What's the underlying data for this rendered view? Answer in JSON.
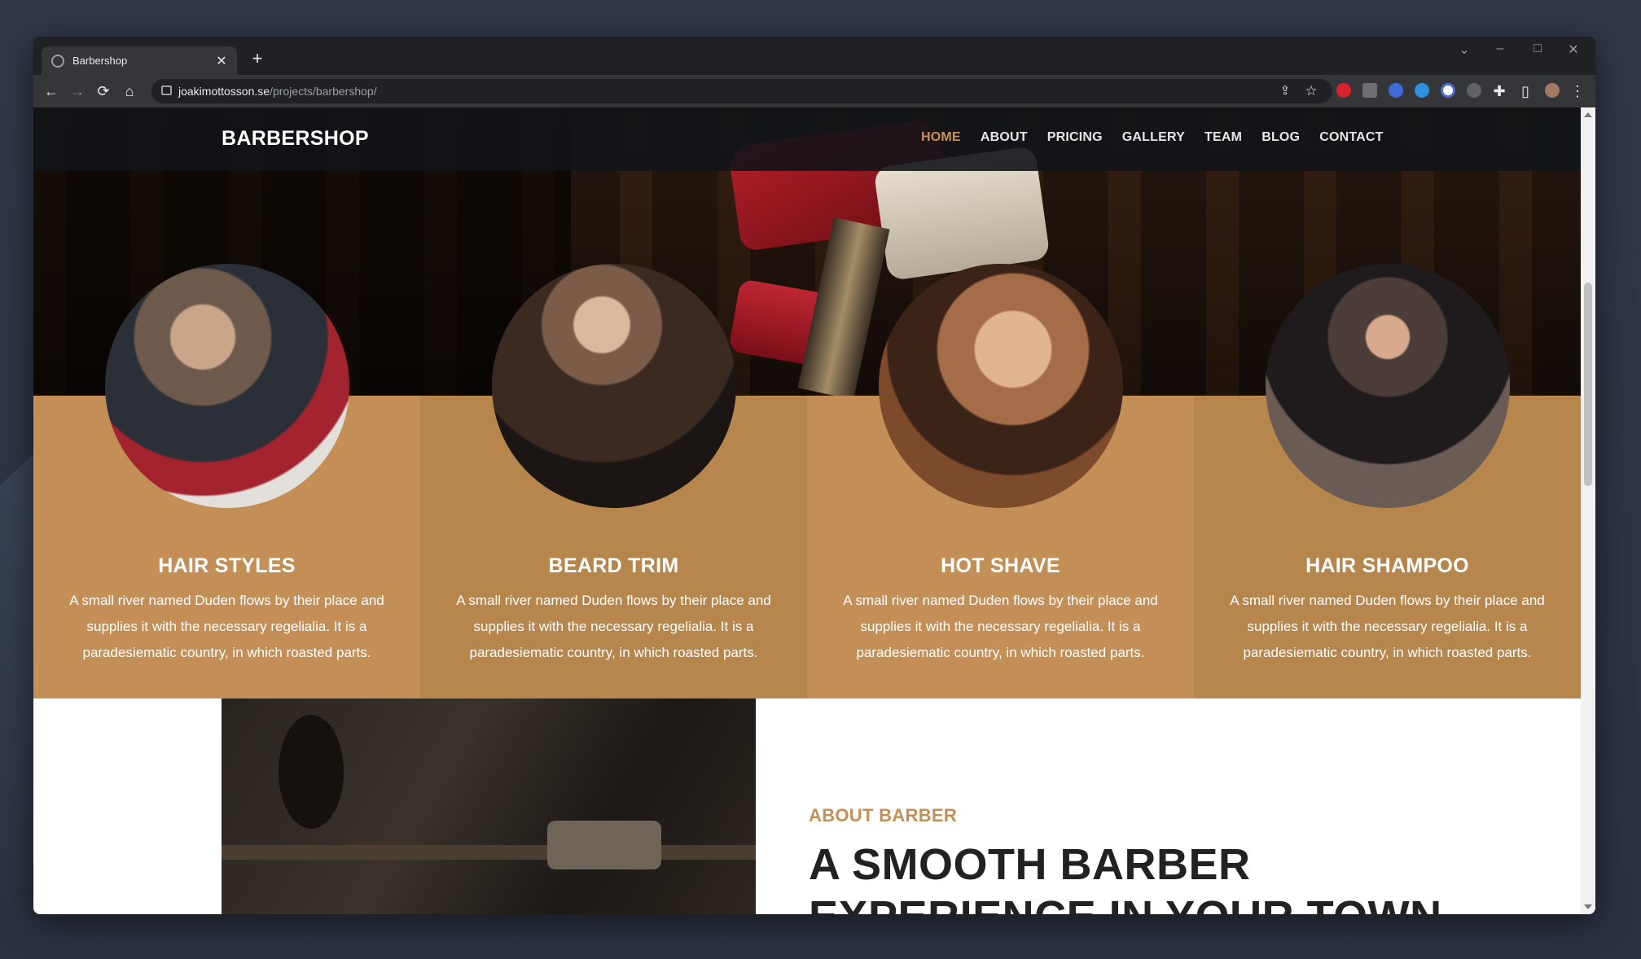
{
  "browser": {
    "tab_title": "Barbershop",
    "new_tab": "+",
    "close_tab": "✕",
    "url_host": "joakimottosson.se",
    "url_path": "/projects/barbershop/",
    "controls": {
      "minimize": "–",
      "maximize": "□",
      "close": "✕",
      "tab_search": "⌄"
    },
    "nav": {
      "back": "←",
      "forward": "→",
      "reload": "⟳",
      "home": "⌂",
      "share": "⇪",
      "bookmark": "☆",
      "extensions": "✚",
      "side_panel": "▯",
      "menu": "⋮"
    }
  },
  "site": {
    "logo": "BARBERSHOP",
    "menu": [
      {
        "label": "HOME",
        "active": true
      },
      {
        "label": "ABOUT"
      },
      {
        "label": "PRICING"
      },
      {
        "label": "GALLERY"
      },
      {
        "label": "TEAM"
      },
      {
        "label": "BLOG"
      },
      {
        "label": "CONTACT"
      }
    ],
    "services": [
      {
        "title": "HAIR STYLES",
        "text": "A small river named Duden flows by their place and supplies it with the necessary regelialia. It is a paradesiematic country, in which roasted parts."
      },
      {
        "title": "BEARD TRIM",
        "text": "A small river named Duden flows by their place and supplies it with the necessary regelialia. It is a paradesiematic country, in which roasted parts."
      },
      {
        "title": "HOT SHAVE",
        "text": "A small river named Duden flows by their place and supplies it with the necessary regelialia. It is a paradesiematic country, in which roasted parts."
      },
      {
        "title": "HAIR SHAMPOO",
        "text": "A small river named Duden flows by their place and supplies it with the necessary regelialia. It is a paradesiematic country, in which roasted parts."
      }
    ],
    "about": {
      "kicker": "ABOUT BARBER",
      "title": "A SMOOTH BARBER EXPERIENCE IN YOUR TOWN"
    }
  },
  "colors": {
    "accent": "#c89254",
    "service_light": "#c38f57",
    "service_dark": "#b7864c"
  }
}
